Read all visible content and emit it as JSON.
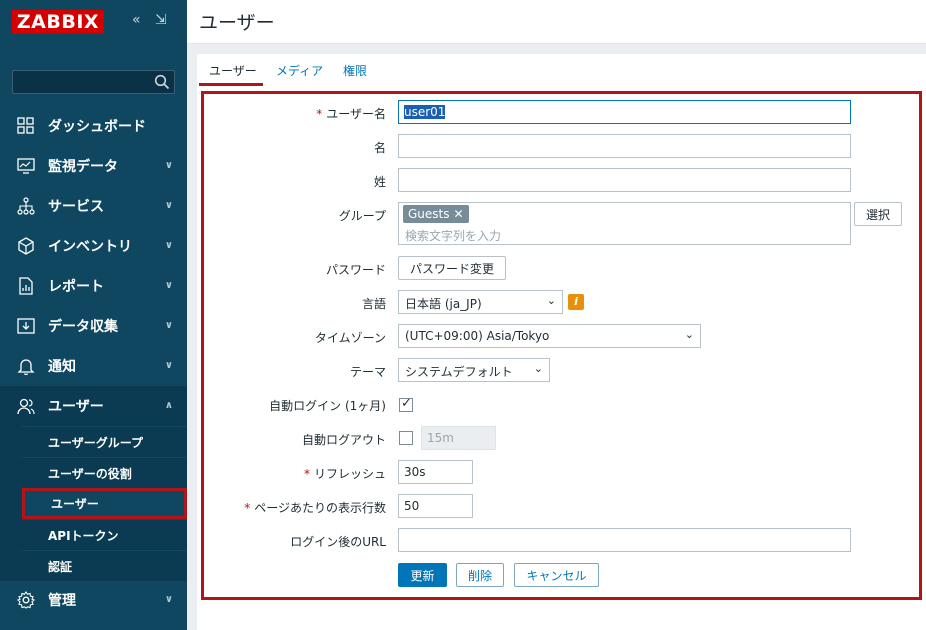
{
  "brand": {
    "logo_text": "ZABBIX"
  },
  "sidebar": {
    "search_placeholder": "",
    "items": [
      {
        "label": "ダッシュボード",
        "icon": "dashboard-icon"
      },
      {
        "label": "監視データ",
        "icon": "monitoring-icon"
      },
      {
        "label": "サービス",
        "icon": "services-icon"
      },
      {
        "label": "インベントリ",
        "icon": "inventory-icon"
      },
      {
        "label": "レポート",
        "icon": "reports-icon"
      },
      {
        "label": "データ収集",
        "icon": "data-collection-icon"
      },
      {
        "label": "通知",
        "icon": "alerts-icon"
      },
      {
        "label": "ユーザー",
        "icon": "users-icon"
      },
      {
        "label": "管理",
        "icon": "administration-icon"
      }
    ],
    "users_submenu": [
      {
        "label": "ユーザーグループ"
      },
      {
        "label": "ユーザーの役割"
      },
      {
        "label": "ユーザー"
      },
      {
        "label": "APIトークン"
      },
      {
        "label": "認証"
      }
    ],
    "active_submenu_index": 2
  },
  "header": {
    "title": "ユーザー"
  },
  "tabs": [
    {
      "label": "ユーザー"
    },
    {
      "label": "メディア"
    },
    {
      "label": "権限"
    }
  ],
  "form": {
    "username": {
      "label": "ユーザー名",
      "value": "user01",
      "required": true
    },
    "name": {
      "label": "名",
      "value": ""
    },
    "surname": {
      "label": "姓",
      "value": ""
    },
    "groups": {
      "label": "グループ",
      "chips": [
        "Guests"
      ],
      "placeholder": "検索文字列を入力",
      "select_button": "選択"
    },
    "password": {
      "label": "パスワード",
      "button": "パスワード変更"
    },
    "language": {
      "label": "言語",
      "value": "日本語 (ja_JP)"
    },
    "timezone": {
      "label": "タイムゾーン",
      "value": "(UTC+09:00) Asia/Tokyo"
    },
    "theme": {
      "label": "テーマ",
      "value": "システムデフォルト"
    },
    "autologin": {
      "label": "自動ログイン (1ヶ月)",
      "checked": true
    },
    "autologout": {
      "label": "自動ログアウト",
      "checked": false,
      "value": "15m"
    },
    "refresh": {
      "label": "リフレッシュ",
      "value": "30s",
      "required": true
    },
    "rows_per_page": {
      "label": "ページあたりの表示行数",
      "value": "50",
      "required": true
    },
    "url": {
      "label": "ログイン後のURL",
      "value": ""
    },
    "buttons": {
      "update": "更新",
      "delete": "削除",
      "cancel": "キャンセル"
    }
  }
}
